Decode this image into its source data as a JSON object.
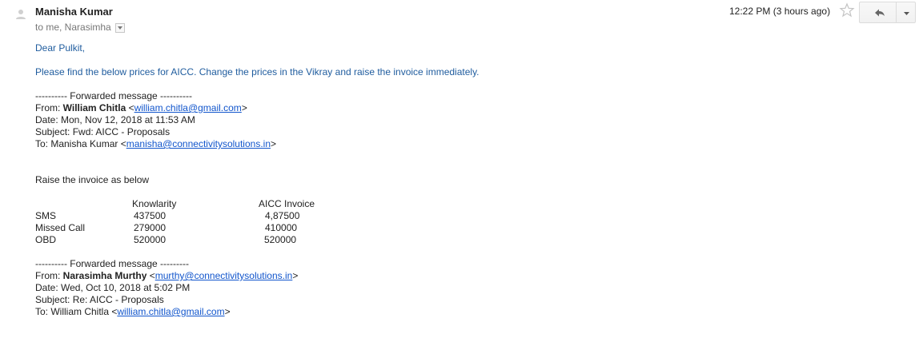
{
  "header": {
    "sender_name": "Manisha Kumar",
    "to_line": "to me, Narasimha",
    "time": "12:22 PM (3 hours ago)"
  },
  "icons": {
    "avatar": "person-avatar-icon",
    "star": "star-icon",
    "reply": "reply-arrow-icon",
    "more": "chevron-down-icon",
    "recipients_dropdown": "dropdown-caret-icon"
  },
  "colors": {
    "message_text": "#1f5c9e",
    "link": "#1155cc",
    "sender": "#222222",
    "muted": "#777777"
  },
  "message": {
    "greeting": "Dear Pulkit,",
    "instruction": "Please find the below prices for AICC. Change the prices in the Vikray and raise the invoice immediately."
  },
  "forward1": {
    "separator": "---------- Forwarded message ----------",
    "from_label": "From: ",
    "from_name": "William Chitla",
    "from_email": "william.chitla@gmail.com",
    "date": "Date: Mon, Nov 12, 2018 at 11:53 AM",
    "subject": "Subject: Fwd: AICC - Proposals",
    "to_label": "To: Manisha Kumar <",
    "to_email": "manisha@connectivitysolutions.in"
  },
  "invoice": {
    "intro": "Raise the invoice as below",
    "columns": [
      "Knowlarity",
      "AICC Invoice"
    ],
    "rows": [
      {
        "label": "SMS",
        "knowlarity": "437500",
        "aicc": "4,87500"
      },
      {
        "label": "Missed Call",
        "knowlarity": "279000",
        "aicc": "410000"
      },
      {
        "label": "OBD",
        "knowlarity": "520000",
        "aicc": "520000"
      }
    ]
  },
  "forward2": {
    "separator": "---------- Forwarded message ---------",
    "from_label": "From: ",
    "from_name": "Narasimha Murthy",
    "from_email": "murthy@connectivitysolutions.in",
    "date": "Date: Wed, Oct 10, 2018 at 5:02 PM",
    "subject": "Subject: Re: AICC - Proposals",
    "to_label": "To: William Chitla <",
    "to_email": "william.chitla@gmail.com"
  }
}
